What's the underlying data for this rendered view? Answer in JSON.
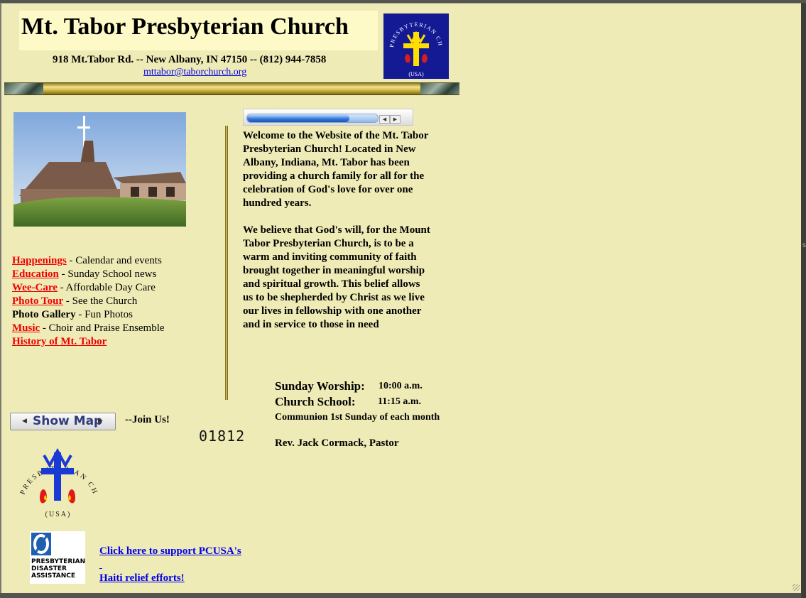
{
  "header": {
    "title": "Mt. Tabor Presbyterian Church",
    "address": "918 Mt.Tabor Rd. -- New Albany, IN  47150 -- (812) 944-7858",
    "email": "mttabor@taborchurch.org"
  },
  "logo": {
    "arc_text": "PRESBYTERIAN CHURCH",
    "bottom_text": "(USA)"
  },
  "media_player": {
    "progress": 0.78
  },
  "nav": [
    {
      "link": "Happenings",
      "desc": " - Calendar and events",
      "is_link": true
    },
    {
      "link": "Education",
      "desc": " - Sunday School news",
      "is_link": true
    },
    {
      "link": "Wee-Care",
      "desc": " - Affordable Day Care",
      "is_link": true
    },
    {
      "link": "Photo Tour",
      "desc": " -  See the Church",
      "is_link": true
    },
    {
      "link": "Photo Gallery",
      "desc": " -    Fun Photos",
      "is_link": false
    },
    {
      "link": "Music",
      "desc": " - Choir and Praise Ensemble",
      "is_link": true
    },
    {
      "link": "History of Mt. Tabor",
      "desc": "",
      "is_link": true
    }
  ],
  "welcome": {
    "p1": "Welcome to the Website of the Mt. Tabor Presbyterian Church! Located in New Albany, Indiana, Mt. Tabor has been providing a church family for all for the celebration of God's love for over one hundred years.",
    "p2": "We believe that God's will, for the Mount Tabor Presbyterian Church, is to be a warm and inviting community of faith brought together in meaningful worship and spiritual growth.  This belief allows us to be shepherded by Christ as we live our lives in fellowship with one another and in service to those in need"
  },
  "services": {
    "worship_label": "Sunday Worship:",
    "worship_time": "10:00 a.m.",
    "school_label": "Church School:",
    "school_time": "11:15 a.m.",
    "communion": "Communion 1st Sunday of each month",
    "pastor": "Rev. Jack Cormack, Pastor"
  },
  "map": {
    "button_label": "Show Map",
    "join": "--Join Us!"
  },
  "counter": "01812",
  "pda": {
    "logo_text": [
      "PRESBYTERIAN",
      "DISASTER",
      "ASSISTANCE"
    ],
    "link_line1": "Click here to support PCUSA's",
    "link_line2": "Haiti relief efforts!"
  },
  "colors": {
    "background": "#efebb6",
    "link_red": "#ee0000",
    "link_blue": "#0000ee",
    "logo_blue": "#141a94"
  }
}
